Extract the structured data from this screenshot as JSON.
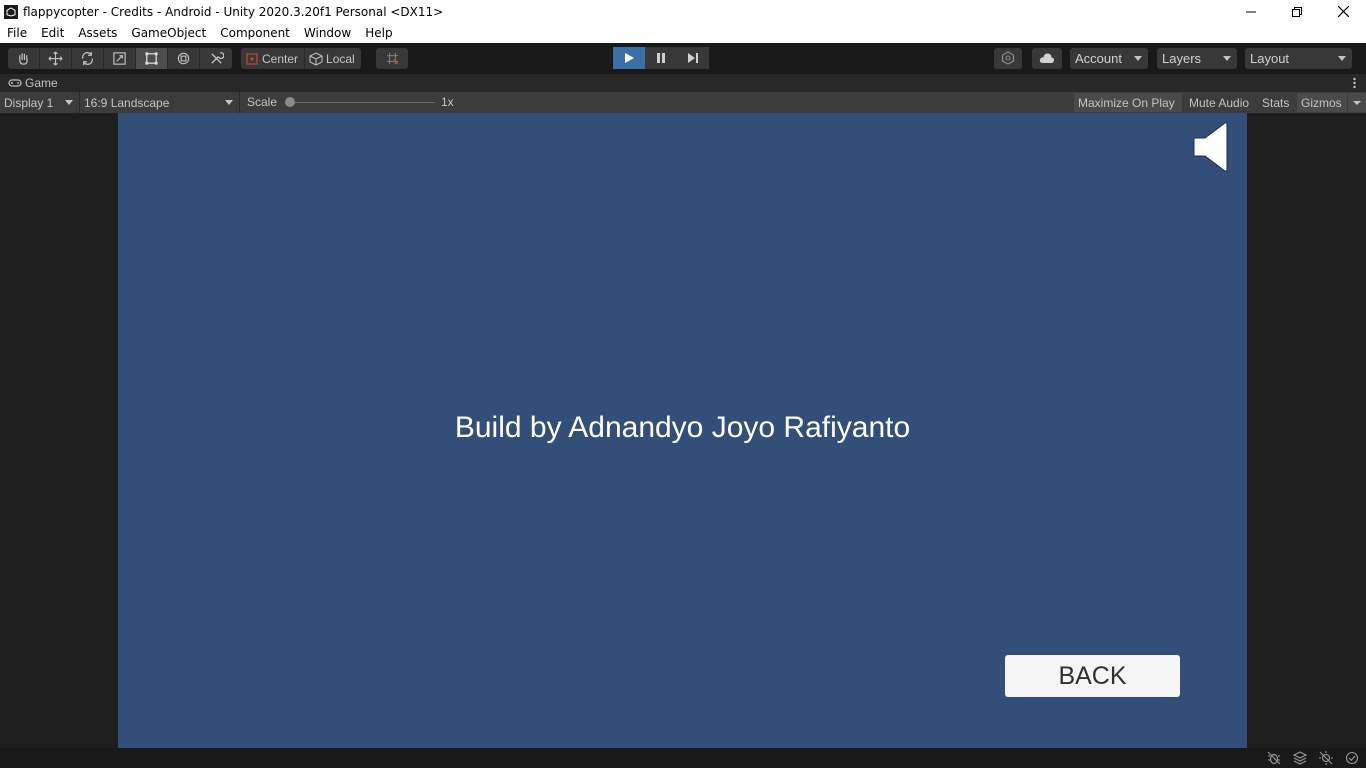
{
  "window": {
    "title": "flappycopter - Credits - Android - Unity 2020.3.20f1 Personal <DX11>"
  },
  "menu": {
    "items": [
      "File",
      "Edit",
      "Assets",
      "GameObject",
      "Component",
      "Window",
      "Help"
    ]
  },
  "toolbar": {
    "pivot_center": "Center",
    "pivot_local": "Local",
    "account": "Account",
    "layers": "Layers",
    "layout": "Layout",
    "tools": [
      "hand-tool",
      "move-tool",
      "rotate-tool",
      "scale-tool",
      "rect-tool",
      "transform-tool",
      "custom-tool"
    ],
    "active_tool": "rect-tool",
    "play_active": true
  },
  "game_view": {
    "tab_label": "Game",
    "display": "Display 1",
    "aspect": "16:9 Landscape",
    "scale_label": "Scale",
    "scale_value": "1x",
    "maximize_on_play": "Maximize On Play",
    "mute_audio": "Mute Audio",
    "stats": "Stats",
    "gizmos": "Gizmos"
  },
  "game": {
    "credit_text": "Build by Adnandyo Joyo Rafiyanto",
    "back_button": "BACK",
    "background_color": "#324e79"
  },
  "colors": {
    "editor_dark": "#191919",
    "play_accent": "#3a6fa8"
  }
}
